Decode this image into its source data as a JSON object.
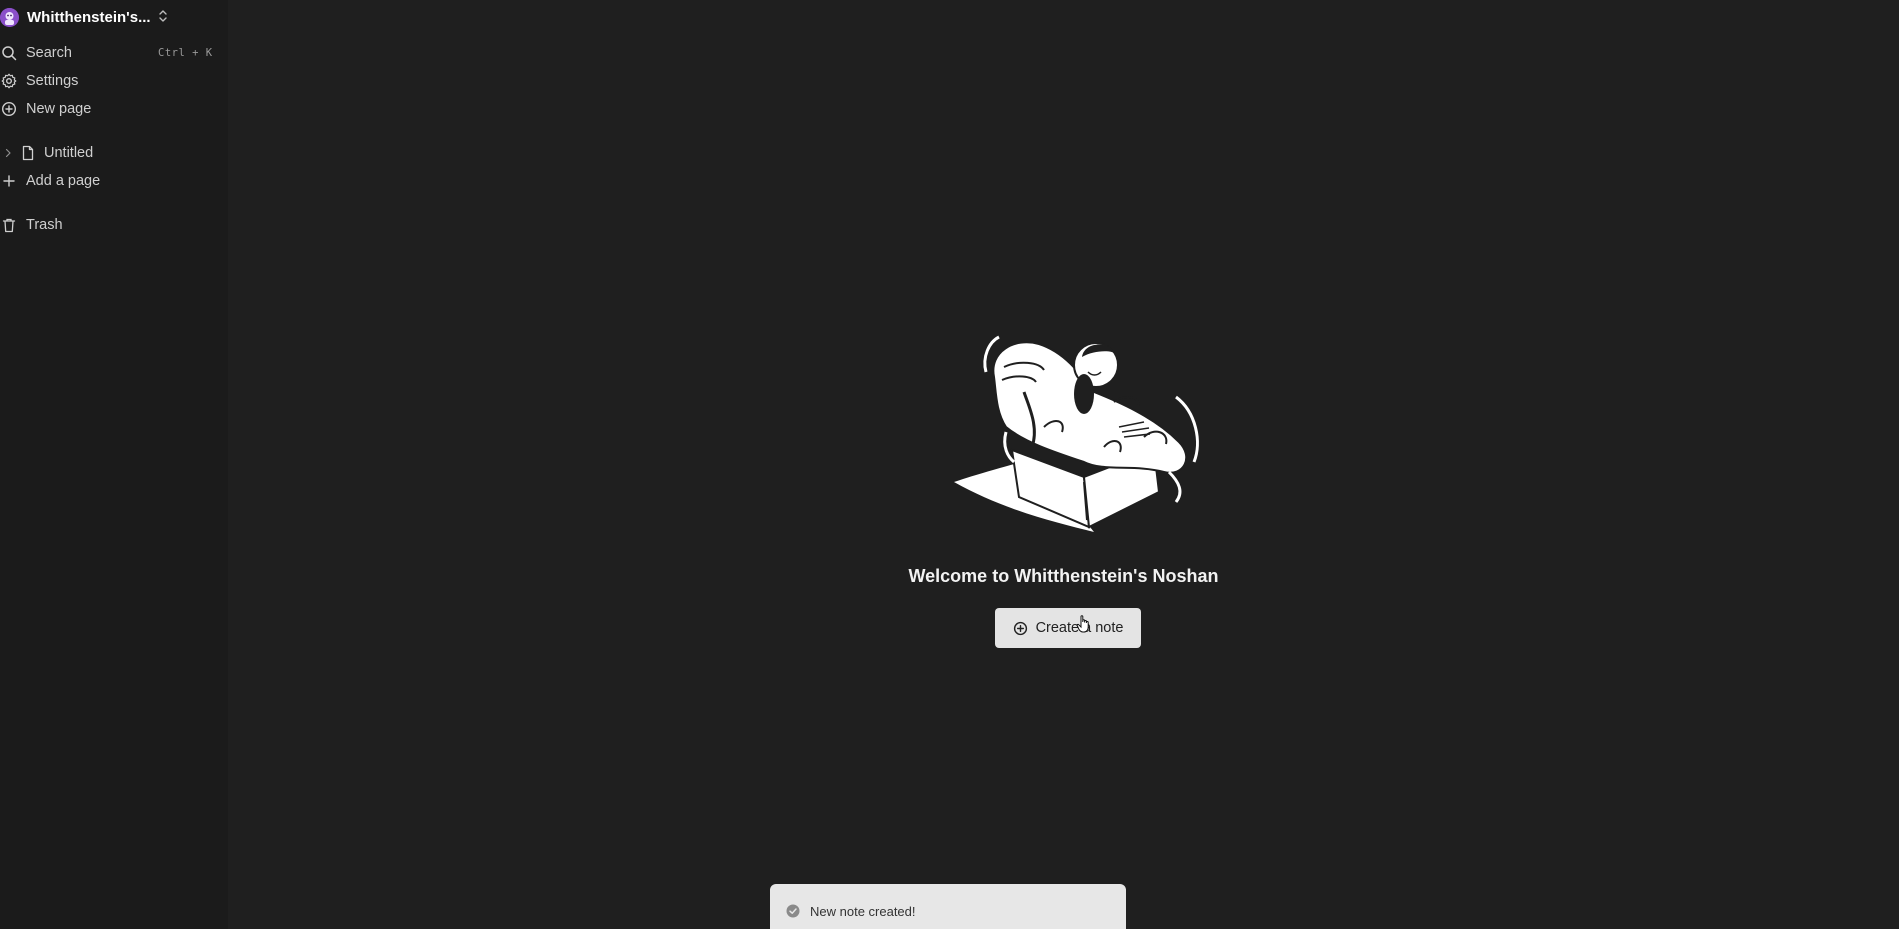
{
  "workspace": {
    "name": "Whitthenstein's...",
    "avatar_color": "#8a4fc9"
  },
  "sidebar": {
    "search": {
      "label": "Search",
      "shortcut": "Ctrl + K",
      "icon": "search-icon"
    },
    "settings": {
      "label": "Settings",
      "icon": "gear-icon"
    },
    "new_page": {
      "label": "New page",
      "icon": "plus-circle-icon"
    },
    "pages": [
      {
        "label": "Untitled",
        "icon": "file-icon"
      }
    ],
    "add_page": {
      "label": "Add a page",
      "icon": "plus-icon"
    },
    "trash": {
      "label": "Trash",
      "icon": "trash-icon"
    }
  },
  "main": {
    "welcome": "Welcome to Whitthenstein's Noshan",
    "create_button": "Create a note"
  },
  "toast": {
    "message": "New note created!",
    "icon": "check-circle-icon"
  },
  "colors": {
    "sidebar_bg": "#1b1b1b",
    "main_bg": "#1f1f1f",
    "button_bg": "#e4e4e4",
    "toast_bg": "#e7e7e7"
  }
}
